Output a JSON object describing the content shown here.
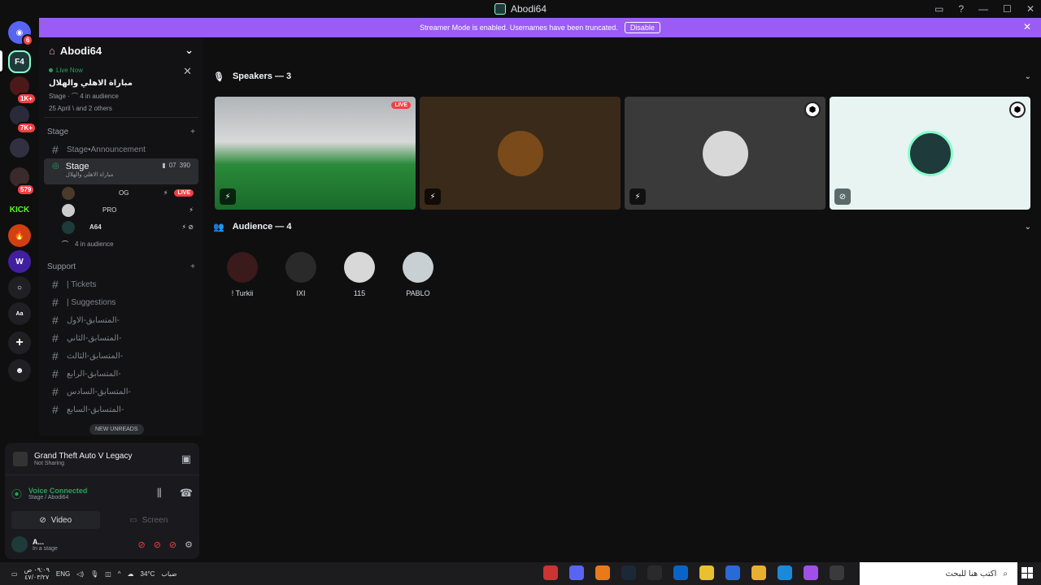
{
  "window": {
    "title": "Abodi64"
  },
  "banner": {
    "text": "Streamer Mode is enabled. Usernames have been truncated.",
    "disable_label": "Disable"
  },
  "guilds": [
    {
      "name": "discord-home",
      "badge": "6"
    },
    {
      "name": "server-r",
      "badge": ""
    },
    {
      "name": "server-a",
      "badge": "1K+"
    },
    {
      "name": "server-b",
      "badge": "7K+"
    },
    {
      "name": "server-c",
      "badge": ""
    },
    {
      "name": "server-d",
      "badge": "579"
    },
    {
      "name": "kick",
      "badge": ""
    }
  ],
  "server": {
    "name": "Abodi64"
  },
  "live_card": {
    "status": "Live Now",
    "title": "مباراة الاهلي والهلال",
    "meta": "Stage · ⌒ 4 in audience",
    "attendees": "25 April \\ and 2 others"
  },
  "categories": {
    "stage": "Stage",
    "support": "Support"
  },
  "channels": {
    "announcement": "Stage•Announcement",
    "stage": {
      "name": "Stage",
      "subtitle": "مباراة الاهلي والهلال",
      "count1": "07",
      "count2": "390"
    },
    "tickets": "| Tickets",
    "suggestions": "| Suggestions",
    "contests": [
      "المتسابق-الاول-",
      "المتسابق-الثاني-",
      "المتسابق-الثالث-",
      "المتسابق-الرابع-",
      "المتسابق-السادس-",
      "المتسابق-السابع-"
    ]
  },
  "stage_users": [
    {
      "name": "OG",
      "live": "LIVE"
    },
    {
      "name": "PRO",
      "live": ""
    },
    {
      "name": "A64",
      "live": ""
    }
  ],
  "audience_count": "4 in audience",
  "new_unreads": "NEW UNREADS",
  "game": {
    "title": "Grand Theft Auto V Legacy",
    "status": "Not Sharing"
  },
  "voice": {
    "status": "Voice Connected",
    "location": "Stage / Abodi64"
  },
  "buttons": {
    "video": "Video",
    "screen": "Screen"
  },
  "user": {
    "name": "A...",
    "status": "In a stage"
  },
  "speakers": {
    "label": "Speakers — 3"
  },
  "audience": {
    "label": "Audience — 4",
    "members": [
      "! Turkii",
      "IXI",
      "115",
      "PABLO"
    ]
  },
  "tiles": {
    "live": "LIVE"
  },
  "taskbar": {
    "time": "٠٩:٠٩ ص",
    "date": "٤٧/٠٣/٢٧",
    "lang": "ENG",
    "weather": "34°C",
    "weather_desc": "ضباب",
    "search_placeholder": "اكتب هنا للبحث"
  },
  "colors": {
    "accent": "#9b5cf5",
    "green": "#23a55a",
    "red": "#f23f43"
  }
}
